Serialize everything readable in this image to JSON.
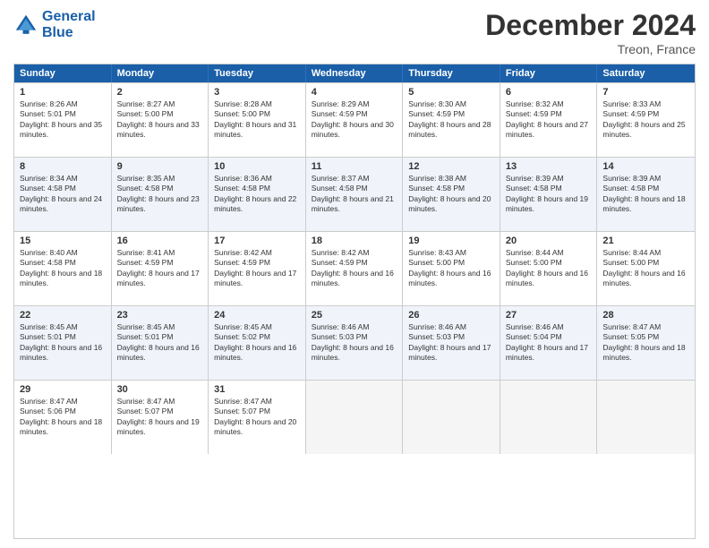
{
  "logo": {
    "line1": "General",
    "line2": "Blue"
  },
  "title": "December 2024",
  "subtitle": "Treon, France",
  "weekdays": [
    "Sunday",
    "Monday",
    "Tuesday",
    "Wednesday",
    "Thursday",
    "Friday",
    "Saturday"
  ],
  "weeks": [
    [
      {
        "day": "1",
        "sunrise": "Sunrise: 8:26 AM",
        "sunset": "Sunset: 5:01 PM",
        "daylight": "Daylight: 8 hours and 35 minutes."
      },
      {
        "day": "2",
        "sunrise": "Sunrise: 8:27 AM",
        "sunset": "Sunset: 5:00 PM",
        "daylight": "Daylight: 8 hours and 33 minutes."
      },
      {
        "day": "3",
        "sunrise": "Sunrise: 8:28 AM",
        "sunset": "Sunset: 5:00 PM",
        "daylight": "Daylight: 8 hours and 31 minutes."
      },
      {
        "day": "4",
        "sunrise": "Sunrise: 8:29 AM",
        "sunset": "Sunset: 4:59 PM",
        "daylight": "Daylight: 8 hours and 30 minutes."
      },
      {
        "day": "5",
        "sunrise": "Sunrise: 8:30 AM",
        "sunset": "Sunset: 4:59 PM",
        "daylight": "Daylight: 8 hours and 28 minutes."
      },
      {
        "day": "6",
        "sunrise": "Sunrise: 8:32 AM",
        "sunset": "Sunset: 4:59 PM",
        "daylight": "Daylight: 8 hours and 27 minutes."
      },
      {
        "day": "7",
        "sunrise": "Sunrise: 8:33 AM",
        "sunset": "Sunset: 4:59 PM",
        "daylight": "Daylight: 8 hours and 25 minutes."
      }
    ],
    [
      {
        "day": "8",
        "sunrise": "Sunrise: 8:34 AM",
        "sunset": "Sunset: 4:58 PM",
        "daylight": "Daylight: 8 hours and 24 minutes."
      },
      {
        "day": "9",
        "sunrise": "Sunrise: 8:35 AM",
        "sunset": "Sunset: 4:58 PM",
        "daylight": "Daylight: 8 hours and 23 minutes."
      },
      {
        "day": "10",
        "sunrise": "Sunrise: 8:36 AM",
        "sunset": "Sunset: 4:58 PM",
        "daylight": "Daylight: 8 hours and 22 minutes."
      },
      {
        "day": "11",
        "sunrise": "Sunrise: 8:37 AM",
        "sunset": "Sunset: 4:58 PM",
        "daylight": "Daylight: 8 hours and 21 minutes."
      },
      {
        "day": "12",
        "sunrise": "Sunrise: 8:38 AM",
        "sunset": "Sunset: 4:58 PM",
        "daylight": "Daylight: 8 hours and 20 minutes."
      },
      {
        "day": "13",
        "sunrise": "Sunrise: 8:39 AM",
        "sunset": "Sunset: 4:58 PM",
        "daylight": "Daylight: 8 hours and 19 minutes."
      },
      {
        "day": "14",
        "sunrise": "Sunrise: 8:39 AM",
        "sunset": "Sunset: 4:58 PM",
        "daylight": "Daylight: 8 hours and 18 minutes."
      }
    ],
    [
      {
        "day": "15",
        "sunrise": "Sunrise: 8:40 AM",
        "sunset": "Sunset: 4:58 PM",
        "daylight": "Daylight: 8 hours and 18 minutes."
      },
      {
        "day": "16",
        "sunrise": "Sunrise: 8:41 AM",
        "sunset": "Sunset: 4:59 PM",
        "daylight": "Daylight: 8 hours and 17 minutes."
      },
      {
        "day": "17",
        "sunrise": "Sunrise: 8:42 AM",
        "sunset": "Sunset: 4:59 PM",
        "daylight": "Daylight: 8 hours and 17 minutes."
      },
      {
        "day": "18",
        "sunrise": "Sunrise: 8:42 AM",
        "sunset": "Sunset: 4:59 PM",
        "daylight": "Daylight: 8 hours and 16 minutes."
      },
      {
        "day": "19",
        "sunrise": "Sunrise: 8:43 AM",
        "sunset": "Sunset: 5:00 PM",
        "daylight": "Daylight: 8 hours and 16 minutes."
      },
      {
        "day": "20",
        "sunrise": "Sunrise: 8:44 AM",
        "sunset": "Sunset: 5:00 PM",
        "daylight": "Daylight: 8 hours and 16 minutes."
      },
      {
        "day": "21",
        "sunrise": "Sunrise: 8:44 AM",
        "sunset": "Sunset: 5:00 PM",
        "daylight": "Daylight: 8 hours and 16 minutes."
      }
    ],
    [
      {
        "day": "22",
        "sunrise": "Sunrise: 8:45 AM",
        "sunset": "Sunset: 5:01 PM",
        "daylight": "Daylight: 8 hours and 16 minutes."
      },
      {
        "day": "23",
        "sunrise": "Sunrise: 8:45 AM",
        "sunset": "Sunset: 5:01 PM",
        "daylight": "Daylight: 8 hours and 16 minutes."
      },
      {
        "day": "24",
        "sunrise": "Sunrise: 8:45 AM",
        "sunset": "Sunset: 5:02 PM",
        "daylight": "Daylight: 8 hours and 16 minutes."
      },
      {
        "day": "25",
        "sunrise": "Sunrise: 8:46 AM",
        "sunset": "Sunset: 5:03 PM",
        "daylight": "Daylight: 8 hours and 16 minutes."
      },
      {
        "day": "26",
        "sunrise": "Sunrise: 8:46 AM",
        "sunset": "Sunset: 5:03 PM",
        "daylight": "Daylight: 8 hours and 17 minutes."
      },
      {
        "day": "27",
        "sunrise": "Sunrise: 8:46 AM",
        "sunset": "Sunset: 5:04 PM",
        "daylight": "Daylight: 8 hours and 17 minutes."
      },
      {
        "day": "28",
        "sunrise": "Sunrise: 8:47 AM",
        "sunset": "Sunset: 5:05 PM",
        "daylight": "Daylight: 8 hours and 18 minutes."
      }
    ],
    [
      {
        "day": "29",
        "sunrise": "Sunrise: 8:47 AM",
        "sunset": "Sunset: 5:06 PM",
        "daylight": "Daylight: 8 hours and 18 minutes."
      },
      {
        "day": "30",
        "sunrise": "Sunrise: 8:47 AM",
        "sunset": "Sunset: 5:07 PM",
        "daylight": "Daylight: 8 hours and 19 minutes."
      },
      {
        "day": "31",
        "sunrise": "Sunrise: 8:47 AM",
        "sunset": "Sunset: 5:07 PM",
        "daylight": "Daylight: 8 hours and 20 minutes."
      },
      null,
      null,
      null,
      null
    ]
  ]
}
